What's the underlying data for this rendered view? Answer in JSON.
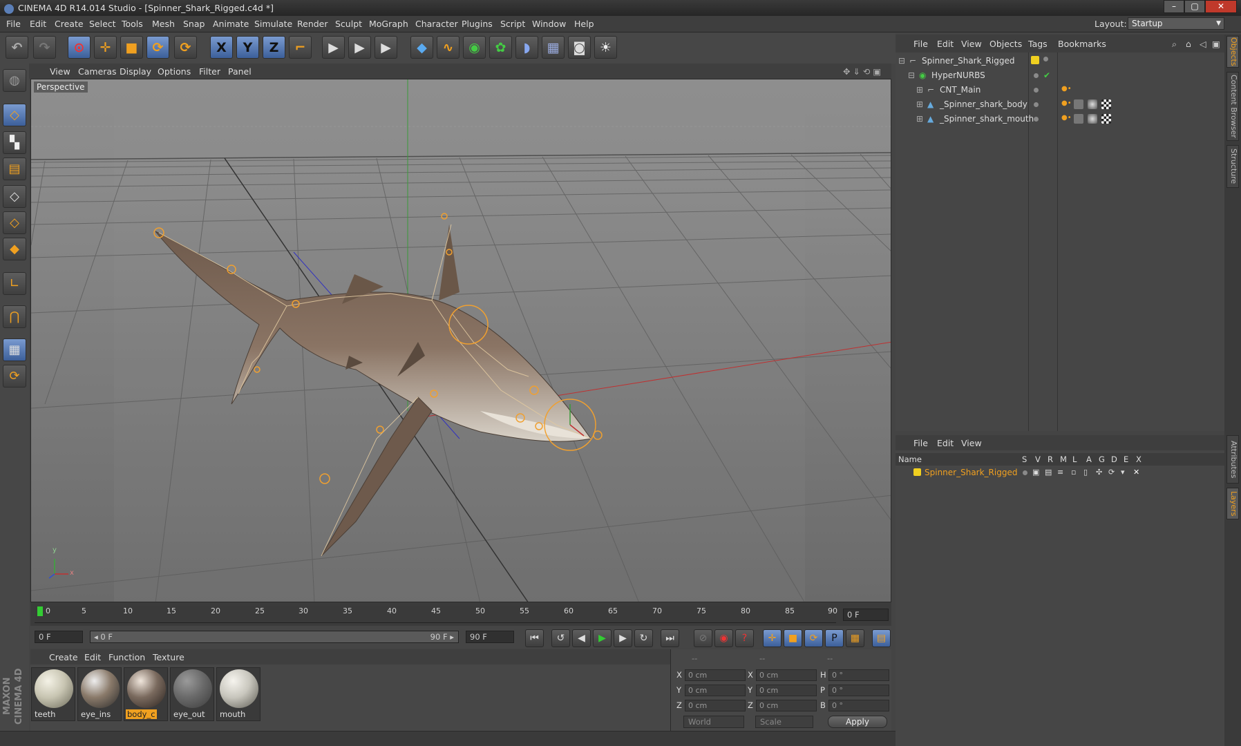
{
  "window": {
    "title": "CINEMA 4D R14.014 Studio - [Spinner_Shark_Rigged.c4d *]",
    "buttons": [
      "–",
      "▢",
      "✕"
    ]
  },
  "menubar": [
    "File",
    "Edit",
    "Create",
    "Select",
    "Tools",
    "Mesh",
    "Snap",
    "Animate",
    "Simulate",
    "Render",
    "Sculpt",
    "MoGraph",
    "Character",
    "Plugins",
    "Script",
    "Window",
    "Help"
  ],
  "layout": {
    "label": "Layout:",
    "value": "Startup"
  },
  "toolbar": {
    "icons": [
      "undo-icon",
      "redo-icon",
      "live-selection-icon",
      "move-icon",
      "scale-icon",
      "rotate-icon",
      "recent-tool-icon",
      "x-axis-icon",
      "y-axis-icon",
      "z-axis-icon",
      "coordinate-system-icon",
      "render-view-icon",
      "render-picture-viewer-icon",
      "edit-render-settings-icon",
      "cube-icon",
      "spline-pen-icon",
      "nurbs-icon",
      "array-icon",
      "deformer-icon",
      "floor-icon",
      "camera-icon",
      "light-icon"
    ],
    "axis_labels": [
      "X",
      "Y",
      "Z"
    ]
  },
  "leftbar": {
    "icons": [
      "make-editable-icon",
      "model-mode-icon",
      "texture-mode-icon",
      "workplane-icon",
      "points-mode-icon",
      "edges-mode-icon",
      "polygons-mode-icon",
      "axis-mode-icon",
      "snap-magnet-icon",
      "workplane-lock-icon",
      "locked-workplane-icon"
    ]
  },
  "viewport": {
    "menu": [
      "View",
      "Cameras",
      "Display",
      "Options",
      "Filter",
      "Panel"
    ],
    "label": "Perspective",
    "axis_x": "x",
    "axis_y": "y"
  },
  "timeline": {
    "ticks": [
      "0",
      "5",
      "10",
      "15",
      "20",
      "25",
      "30",
      "35",
      "40",
      "45",
      "50",
      "55",
      "60",
      "65",
      "70",
      "75",
      "80",
      "85",
      "90"
    ],
    "current_frame": "0 F"
  },
  "time_controls": {
    "start_frame": "0 F",
    "range_start": "◂ 0 F",
    "range_end": "90 F ▸",
    "end_frame": "90 F",
    "buttons": [
      "go-to-start-icon",
      "previous-key-icon",
      "previous-frame-icon",
      "play-icon",
      "next-frame-icon",
      "next-key-icon",
      "go-to-end-icon",
      "record-keys-icon",
      "autokey-icon",
      "keyframe-selection-icon",
      "position-key-icon",
      "scale-key-icon",
      "rotation-key-icon",
      "parameter-key-icon",
      "point-level-icon",
      "timeline-icon"
    ]
  },
  "materials": {
    "menu": [
      "Create",
      "Edit",
      "Function",
      "Texture"
    ],
    "items": [
      {
        "label": "teeth",
        "selected": false,
        "color": "#c8c5b2"
      },
      {
        "label": "eye_ins",
        "selected": false,
        "color": "#8a7a6a"
      },
      {
        "label": "body_c",
        "selected": true,
        "color": "#7a6a5e"
      },
      {
        "label": "eye_out",
        "selected": false,
        "color": "#6a6a6a"
      },
      {
        "label": "mouth",
        "selected": false,
        "color": "#c8c6bd"
      }
    ]
  },
  "coordinates": {
    "headers": [
      "--",
      "--",
      "--"
    ],
    "rows": [
      {
        "a": "X",
        "av": "0 cm",
        "b": "X",
        "bv": "0 cm",
        "c": "H",
        "cv": "0 °"
      },
      {
        "a": "Y",
        "av": "0 cm",
        "b": "Y",
        "bv": "0 cm",
        "c": "P",
        "cv": "0 °"
      },
      {
        "a": "Z",
        "av": "0 cm",
        "b": "Z",
        "bv": "0 cm",
        "c": "B",
        "cv": "0 °"
      }
    ],
    "space": "World",
    "mode": "Scale",
    "apply": "Apply"
  },
  "object_manager": {
    "menu": [
      "File",
      "Edit",
      "View",
      "Objects",
      "Tags",
      "Bookmarks"
    ],
    "objects": [
      {
        "name": "Spinner_Shark_Rigged",
        "indent": 0
      },
      {
        "name": "HyperNURBS",
        "indent": 1
      },
      {
        "name": "CNT_Main",
        "indent": 2
      },
      {
        "name": "_Spinner_shark_body",
        "indent": 2
      },
      {
        "name": "_Spinner_shark_mouth",
        "indent": 2
      }
    ]
  },
  "layer_manager": {
    "menu": [
      "File",
      "Edit",
      "View"
    ],
    "columns": [
      "Name",
      "S",
      "V",
      "R",
      "M",
      "L",
      "A",
      "G",
      "D",
      "E",
      "X"
    ],
    "layers": [
      {
        "name": "Spinner_Shark_Rigged",
        "color": "#f0d020"
      }
    ]
  },
  "side_tabs": [
    "Objects",
    "Content Browser",
    "Structure",
    "Attributes",
    "Layers"
  ],
  "brand": {
    "line1": "MAXON",
    "line2": "CINEMA 4D"
  },
  "colors": {
    "accent": "#f0a020",
    "selection": "#5b7fb8",
    "layer_name": "#f0a020"
  }
}
